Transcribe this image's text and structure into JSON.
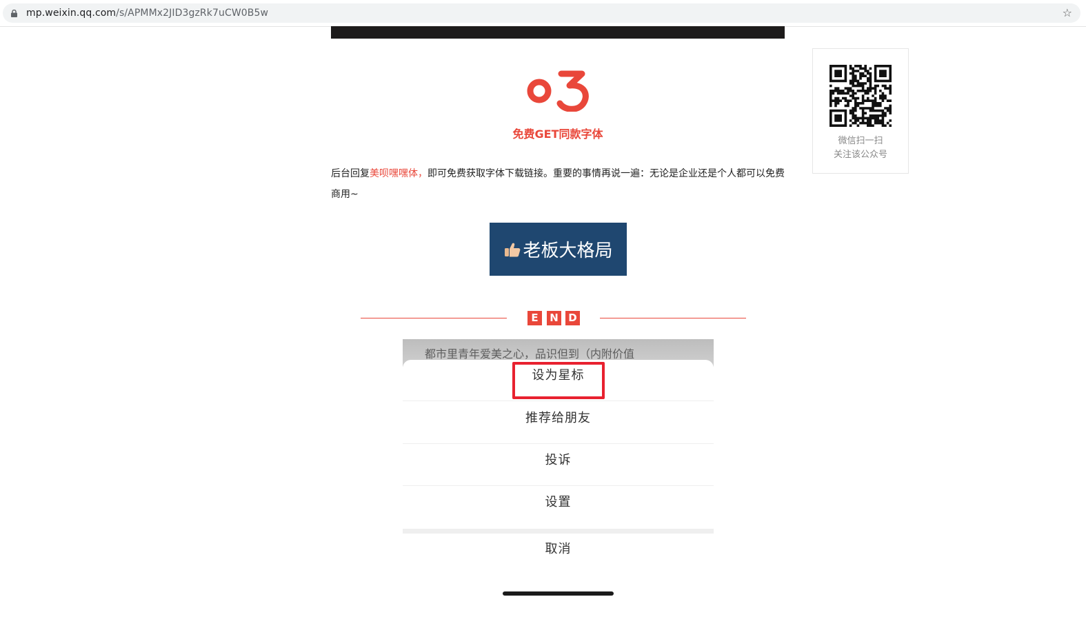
{
  "browser": {
    "url_host": "mp.weixin.qq.com",
    "url_path": "/s/APMMx2JID3gzRk7uCW0B5w",
    "lock_icon": "lock-icon",
    "star_icon": "star-icon"
  },
  "article": {
    "section_number": "03",
    "subtitle": "免费GET同款字体",
    "para_pre": "后台回复",
    "para_highlight": "美呗嘿嘿体，",
    "para_post": "即可免费获取字体下载链接。重要的事情再说一遍：无论是企业还是个人都可以免费商用~",
    "boss_label": "老板大格局",
    "end_letters": [
      "E",
      "N",
      "D"
    ]
  },
  "phone_menu": {
    "behind_text": "都市里青年爱美之心，品识但到（内附价值",
    "items": [
      "设为星标",
      "推荐给朋友",
      "投诉",
      "设置"
    ],
    "cancel": "取消"
  },
  "qr_panel": {
    "caption_line1": "微信扫一扫",
    "caption_line2": "关注该公众号"
  },
  "colors": {
    "accent_red": "#e9473a",
    "boss_bg": "#1f4770",
    "highlight_box": "#e8212f"
  }
}
